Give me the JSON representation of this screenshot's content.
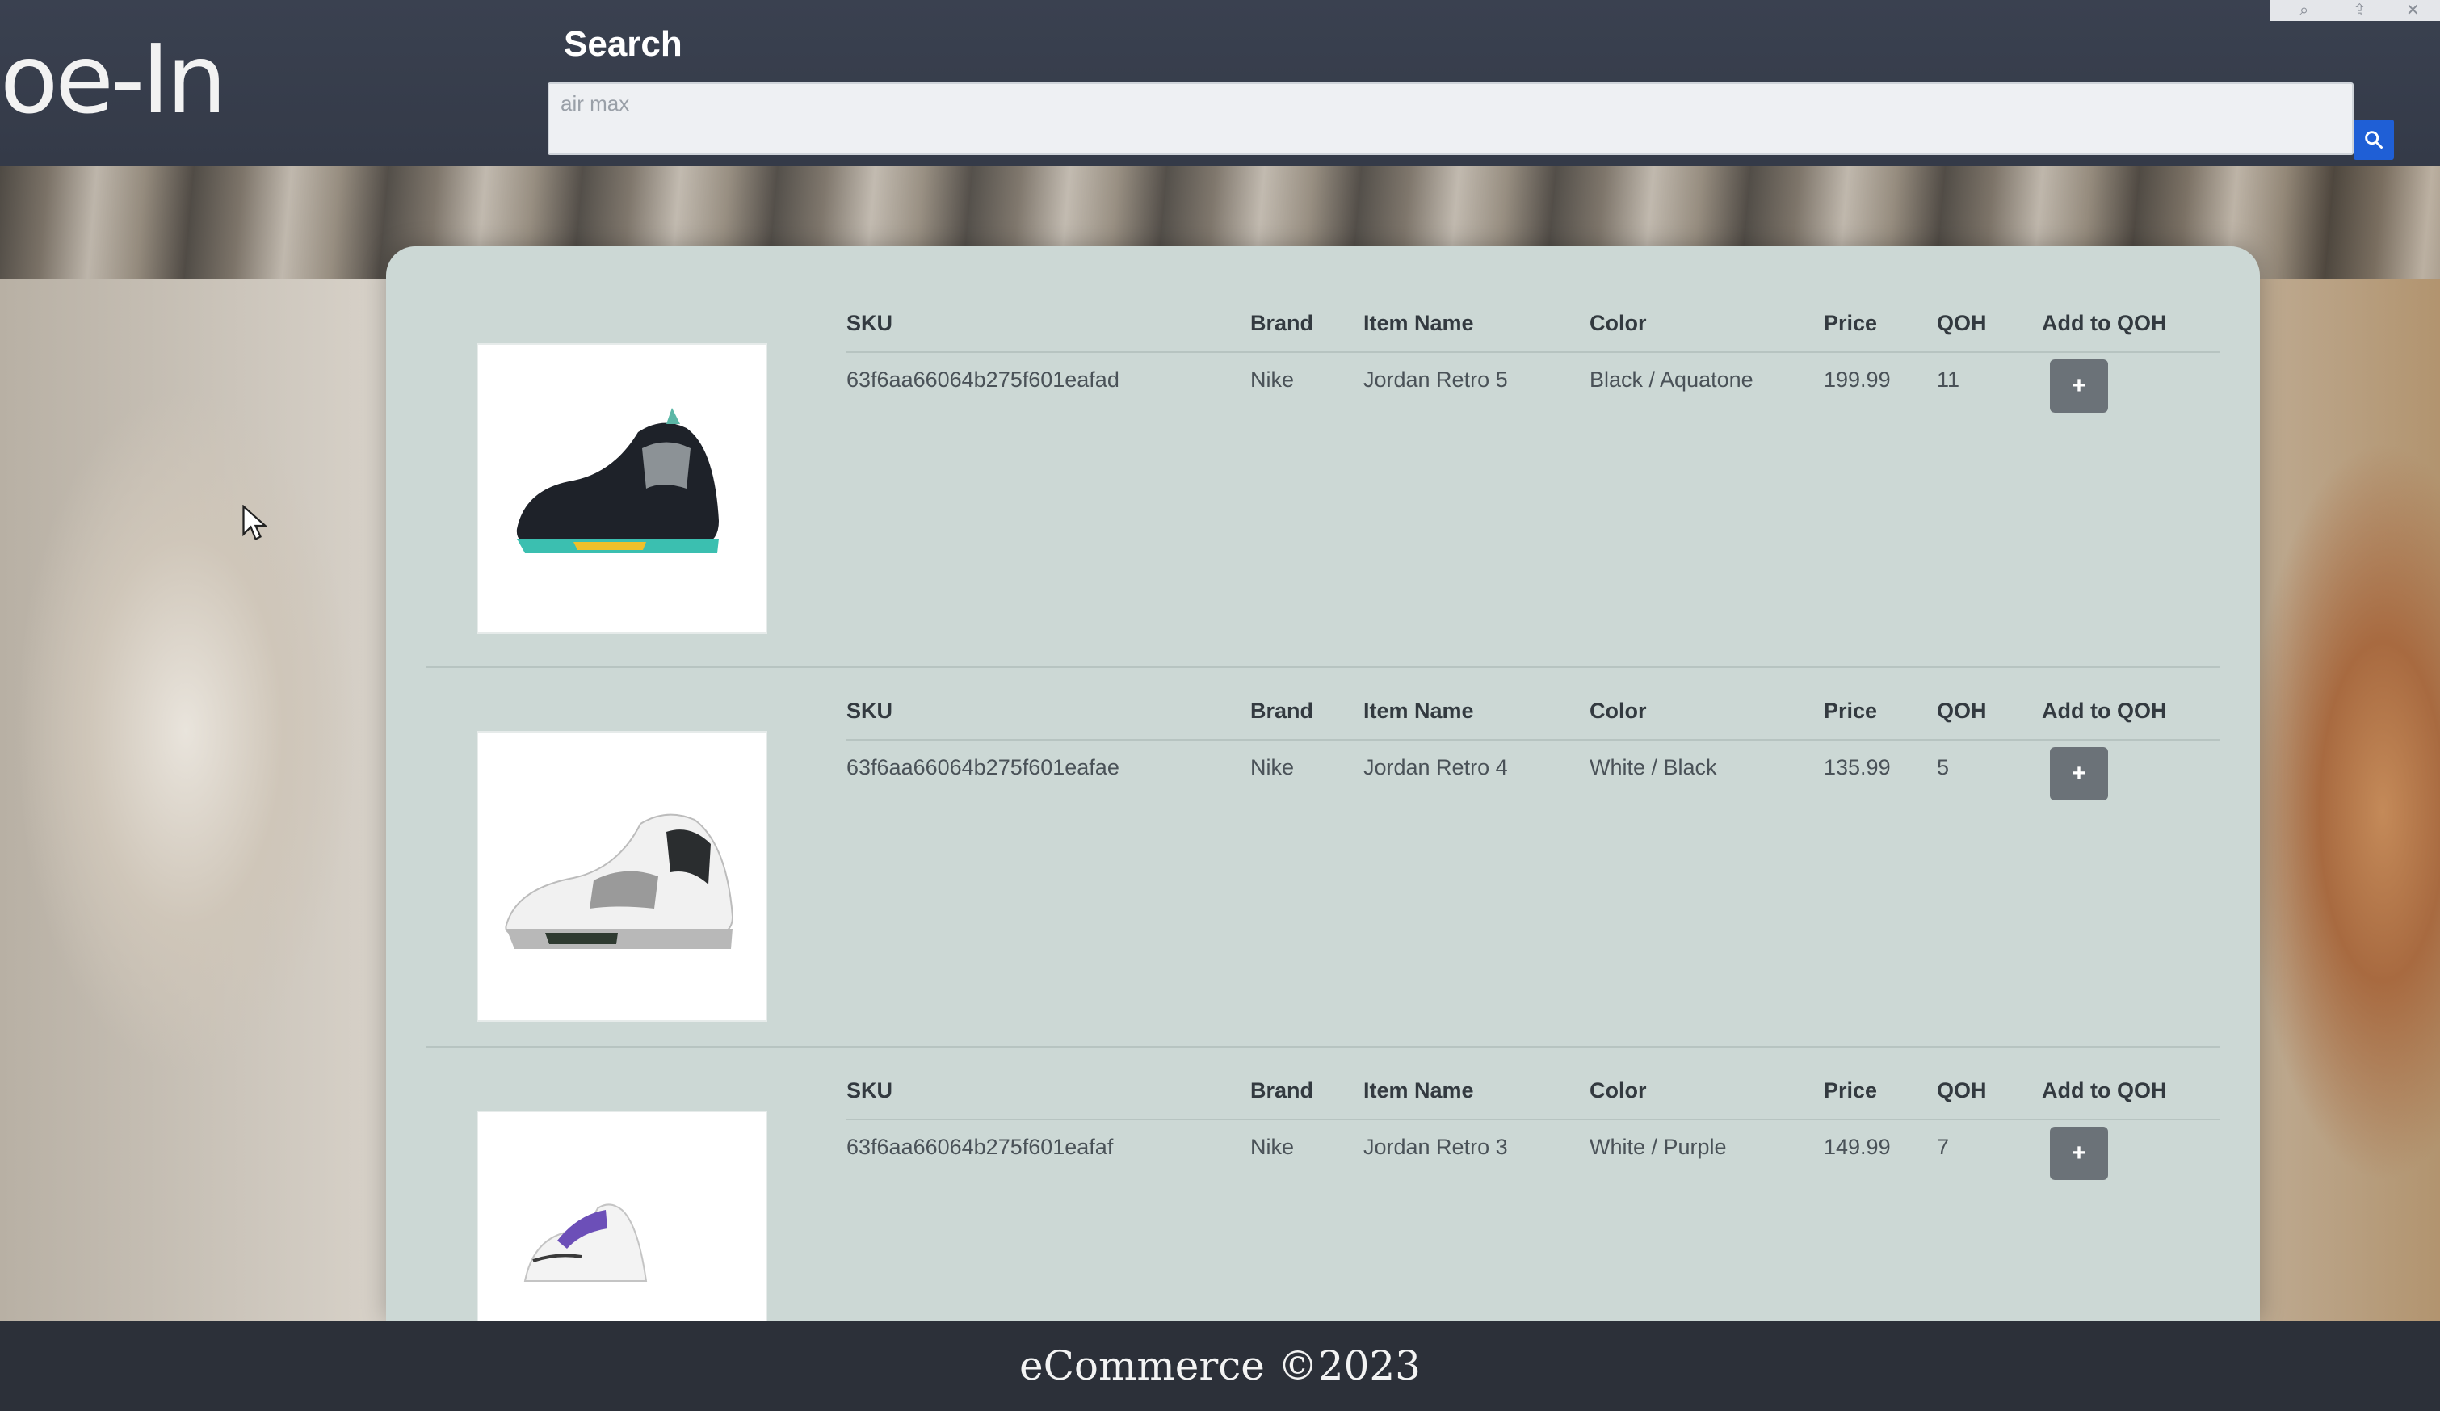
{
  "header": {
    "logo_text": "oe-In",
    "search_label": "Search",
    "search_placeholder": "air max"
  },
  "table_headers": {
    "sku": "SKU",
    "brand": "Brand",
    "item_name": "Item Name",
    "color": "Color",
    "price": "Price",
    "qoh": "QOH",
    "add_to_qoh": "Add to QOH"
  },
  "products": [
    {
      "sku": "63f6aa66064b275f601eafad",
      "brand": "Nike",
      "item_name": "Jordan Retro 5",
      "color": "Black / Aquatone",
      "price": "199.99",
      "qoh": "11",
      "add_label": "+"
    },
    {
      "sku": "63f6aa66064b275f601eafae",
      "brand": "Nike",
      "item_name": "Jordan Retro 4",
      "color": "White / Black",
      "price": "135.99",
      "qoh": "5",
      "add_label": "+"
    },
    {
      "sku": "63f6aa66064b275f601eafaf",
      "brand": "Nike",
      "item_name": "Jordan Retro 3",
      "color": "White / Purple",
      "price": "149.99",
      "qoh": "7",
      "add_label": "+"
    }
  ],
  "footer": {
    "text": "eCommerce ©2023"
  },
  "colors": {
    "header_bg": "#3a4150",
    "panel_bg": "#ccd8d5",
    "search_button": "#1f5fd6",
    "add_button": "#6b7278"
  }
}
